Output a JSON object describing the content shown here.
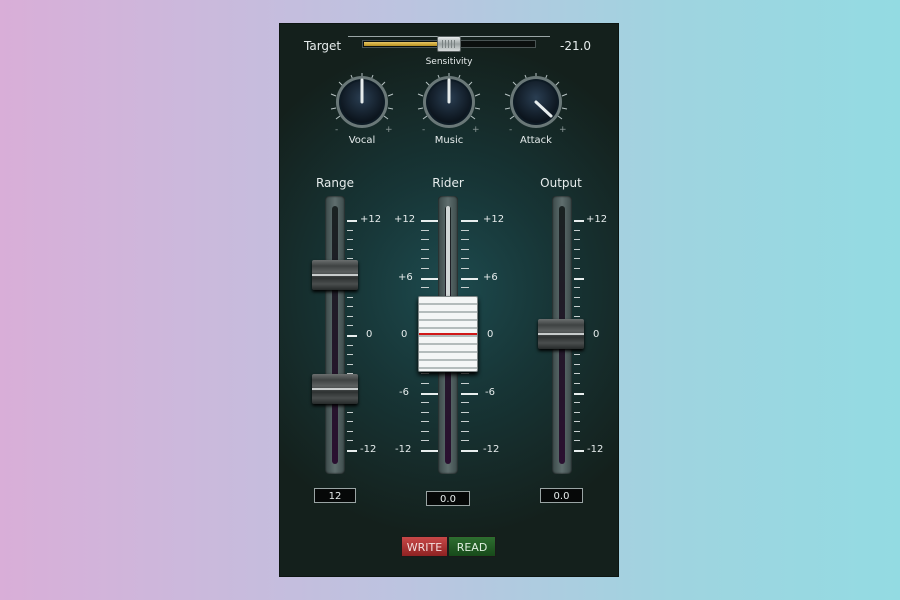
{
  "target": {
    "label": "Target",
    "value": "-21.0",
    "level": 0.48
  },
  "sensitivity": {
    "label": "Sensitivity"
  },
  "knobs": [
    {
      "label": "Vocal",
      "minus": "-",
      "plus": "+",
      "position": 0.5
    },
    {
      "label": "Music",
      "minus": "-",
      "plus": "+",
      "position": 0.5
    },
    {
      "label": "Attack",
      "minus": "-",
      "plus": "+",
      "position": 0.73
    }
  ],
  "faders": {
    "range": {
      "title": "Range",
      "readout": "12",
      "scale": [
        "+12",
        "0",
        "-12"
      ]
    },
    "rider": {
      "title": "Rider",
      "readout": "0.0",
      "scale_left": [
        "+12",
        "+6",
        "0",
        "-6",
        "-12"
      ],
      "scale_right": [
        "+12",
        "+6",
        "0",
        "-6",
        "-12"
      ]
    },
    "output": {
      "title": "Output",
      "readout": "0.0",
      "scale": [
        "+12",
        "0",
        "-12"
      ]
    }
  },
  "buttons": {
    "write": "WRITE",
    "read": "READ"
  },
  "colors": {
    "write": "#b03434",
    "read": "#245c26",
    "target_fill": "#d4a83a"
  }
}
